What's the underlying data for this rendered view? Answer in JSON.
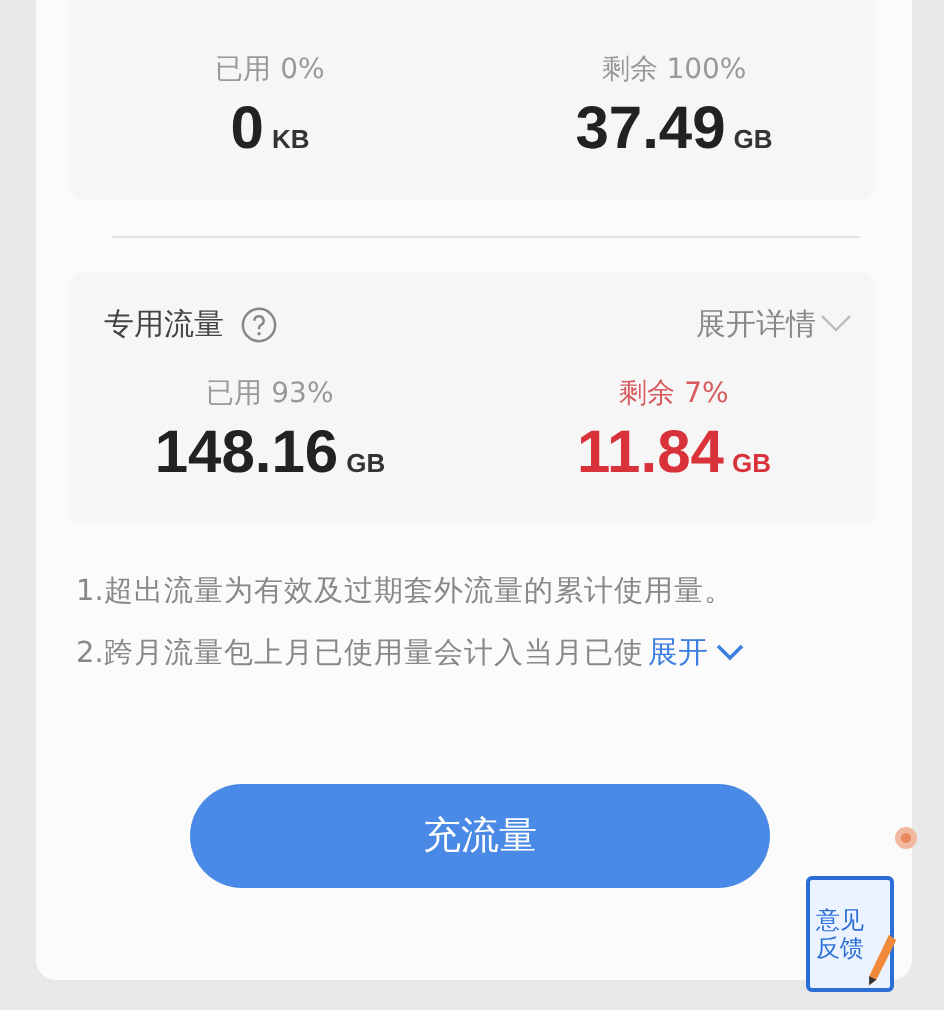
{
  "cards": [
    {
      "stats": [
        {
          "label": "已用 0%",
          "value": "0",
          "unit": "KB",
          "alert": false
        },
        {
          "label": "剩余 100%",
          "value": "37.49",
          "unit": "GB",
          "alert": false
        }
      ]
    },
    {
      "title": "专用流量",
      "details_link": "展开详情",
      "stats": [
        {
          "label": "已用 93%",
          "value": "148.16",
          "unit": "GB",
          "alert": false
        },
        {
          "label": "剩余 7%",
          "value": "11.84",
          "unit": "GB",
          "alert": true
        }
      ]
    }
  ],
  "notes": [
    "1.超出流量为有效及过期套外流量的累计使用量。",
    "2.跨月流量包上月已使用量会计入当月已使"
  ],
  "notes_expand": "展开",
  "recharge_button": "充流量",
  "feedback": "意见反馈"
}
